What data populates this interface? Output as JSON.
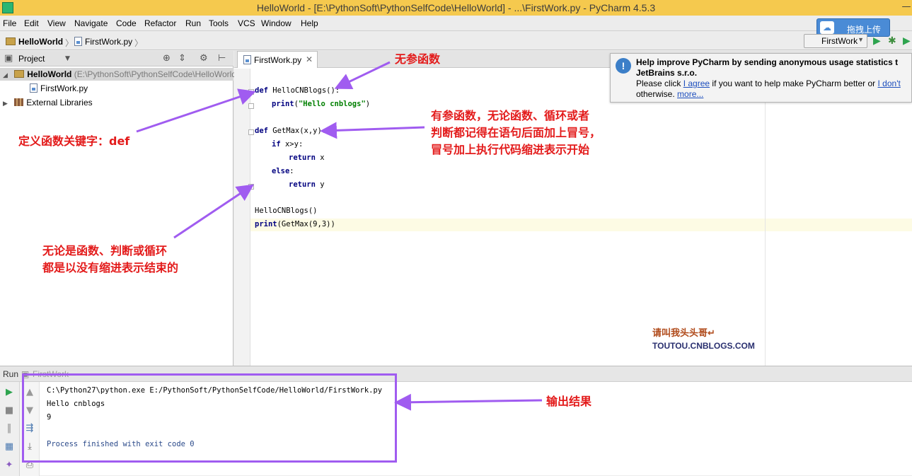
{
  "window": {
    "title": "HelloWorld - [E:\\PythonSoft\\PythonSelfCode\\HelloWorld] - ...\\FirstWork.py - PyCharm 4.5.3"
  },
  "menu": [
    "File",
    "Edit",
    "View",
    "Navigate",
    "Code",
    "Refactor",
    "Run",
    "Tools",
    "VCS",
    "Window",
    "Help"
  ],
  "breadcrumb": {
    "project": "HelloWorld",
    "file": "FirstWork.py"
  },
  "toolbar": {
    "run_config": "FirstWork",
    "upload_label": "拖拽上传"
  },
  "project_panel": {
    "title": "Project",
    "root_name": "HelloWorld",
    "root_path": "(E:\\PythonSoft\\PythonSelfCode\\HelloWorld)",
    "file": "FirstWork.py",
    "libraries": "External Libraries"
  },
  "editor": {
    "tab": "FirstWork.py",
    "code": {
      "l1_kw": "def",
      "l1_rest": " HelloCNBlogs():",
      "l2_kw": "print",
      "l2_open": "(",
      "l2_str": "\"Hello cnblogs\"",
      "l2_close": ")",
      "l4_kw": "def",
      "l4_rest": " GetMax(x,y):",
      "l5_kw": "if",
      "l5_rest": " x>y:",
      "l6_kw": "return",
      "l6_rest": " x",
      "l7_kw": "else",
      "l7_rest": ":",
      "l8_kw": "return",
      "l8_rest": " y",
      "l10": "HelloCNBlogs()",
      "l11_kw": "print",
      "l11_rest": "(GetMax(9,3))"
    }
  },
  "notification": {
    "line1": "Help improve PyCharm by sending anonymous usage statistics t",
    "line2": "JetBrains s.r.o.",
    "line3_pre": "Please click ",
    "agree": "I agree",
    "line3_mid": " if you want to help make PyCharm better or ",
    "dont": "I don't",
    "line4_pre": "otherwise. ",
    "more": "more..."
  },
  "run_panel": {
    "label": "Run",
    "config": "FirstWork",
    "output": [
      "C:\\Python27\\python.exe E:/PythonSoft/PythonSelfCode/HelloWorld/FirstWork.py",
      "Hello cnblogs",
      "9",
      "",
      "Process finished with exit code 0"
    ]
  },
  "annotations": {
    "no_param": "无参函数",
    "def_keyword": "定义函数关键字：def",
    "with_param_1": "有参函数，无论函数、循环或者",
    "with_param_2": "判断都记得在语句后面加上冒号，",
    "with_param_3": "冒号加上执行代码缩进表示开始",
    "end_1": "无论是函数、判断或循环",
    "end_2": "都是以没有缩进表示结束的",
    "output": "输出结果",
    "signature_cn": "请叫我头头哥↵",
    "signature_url": "TOUTOU.CNBLOGS.COM"
  },
  "colors": {
    "annotation_red": "#e31b1b",
    "arrow_purple": "#a05cf0",
    "titlebar": "#f5c94e"
  }
}
